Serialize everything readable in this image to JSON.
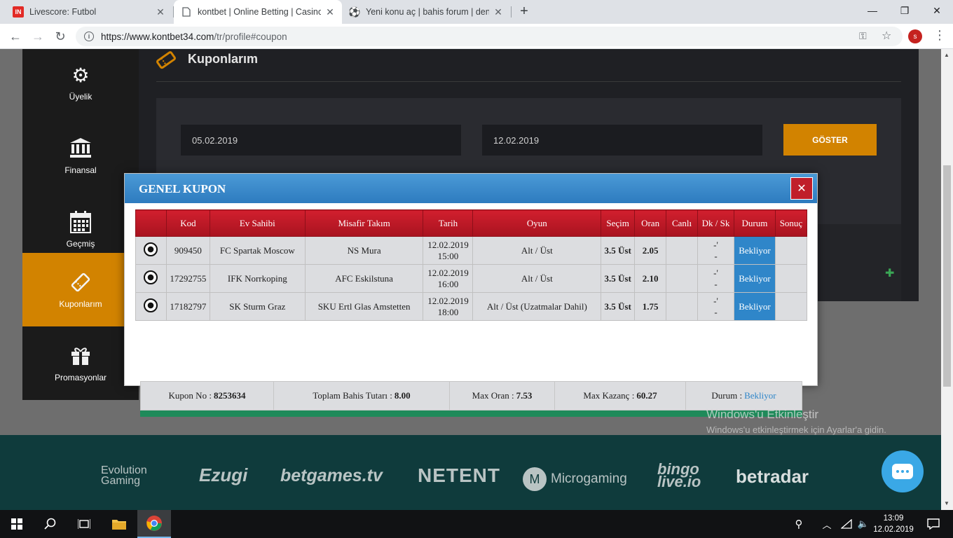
{
  "browser": {
    "tabs": [
      {
        "favicon": "IN",
        "title": "Livescore: Futbol"
      },
      {
        "favicon": "doc-icon",
        "title": "kontbet | Online Betting | Casino"
      },
      {
        "favicon": "soccer-ball-icon",
        "title": "Yeni konu aç | bahis forum | dene"
      }
    ],
    "url_host": "https://www.kontbet34.com",
    "url_path": "/tr/profile#coupon",
    "profile_initial": "s"
  },
  "sidebar": {
    "items": [
      {
        "label": "Üyelik",
        "icon": "gear-icon"
      },
      {
        "label": "Finansal",
        "icon": "bank-icon"
      },
      {
        "label": "Geçmiş",
        "icon": "calendar-icon"
      },
      {
        "label": "Kuponlarım",
        "icon": "ticket-icon"
      },
      {
        "label": "Promasyonlar",
        "icon": "gift-icon"
      }
    ]
  },
  "panel": {
    "title": "Kuponlarım",
    "date_from": "05.02.2019",
    "date_to": "12.02.2019",
    "show_button": "GÖSTER"
  },
  "modal": {
    "title": "GENEL KUPON",
    "headers": [
      "",
      "Kod",
      "Ev Sahibi",
      "Misafir Takım",
      "Tarih",
      "Oyun",
      "Seçim",
      "Oran",
      "Canlı",
      "Dk / Sk",
      "Durum",
      "Sonuç"
    ],
    "rows": [
      {
        "kod": "909450",
        "ev": "FC Spartak Moscow",
        "misafir": "NS Mura",
        "tarih_date": "12.02.2019",
        "tarih_time": "15:00",
        "oyun": "Alt / Üst",
        "secim": "3.5 Üst",
        "oran": "2.05",
        "canli": "",
        "dk": "-'",
        "sk": "-",
        "durum": "Bekliyor",
        "sonuc": ""
      },
      {
        "kod": "17292755",
        "ev": "IFK Norrkoping",
        "misafir": "AFC Eskilstuna",
        "tarih_date": "12.02.2019",
        "tarih_time": "16:00",
        "oyun": "Alt / Üst",
        "secim": "3.5 Üst",
        "oran": "2.10",
        "canli": "",
        "dk": "-'",
        "sk": "-",
        "durum": "Bekliyor",
        "sonuc": ""
      },
      {
        "kod": "17182797",
        "ev": "SK Sturm Graz",
        "misafir": "SKU Ertl Glas Amstetten",
        "tarih_date": "12.02.2019",
        "tarih_time": "18:00",
        "oyun": "Alt / Üst (Uzatmalar Dahil)",
        "secim": "3.5 Üst",
        "oran": "1.75",
        "canli": "",
        "dk": "-'",
        "sk": "-",
        "durum": "Bekliyor",
        "sonuc": ""
      }
    ],
    "summary": {
      "kupon_no_label": "Kupon No :",
      "kupon_no": "8253634",
      "toplam_label": "Toplam Bahis Tutarı :",
      "toplam": "8.00",
      "max_oran_label": "Max Oran :",
      "max_oran": "7.53",
      "max_kazanc_label": "Max Kazanç :",
      "max_kazanc": "60.27",
      "durum_label": "Durum :",
      "durum": "Bekliyor"
    }
  },
  "footer": {
    "logos": [
      "Evolution Gaming",
      "Ezugi",
      "betgames.tv",
      "NETENT",
      "Microgaming",
      "bingo live.io",
      "betradar"
    ],
    "watermark_title": "Windows'u Etkinleştir",
    "watermark_sub": "Windows'u etkinleştirmek için Ayarlar'a gidin."
  },
  "taskbar": {
    "time": "13:09",
    "date": "12.02.2019"
  }
}
